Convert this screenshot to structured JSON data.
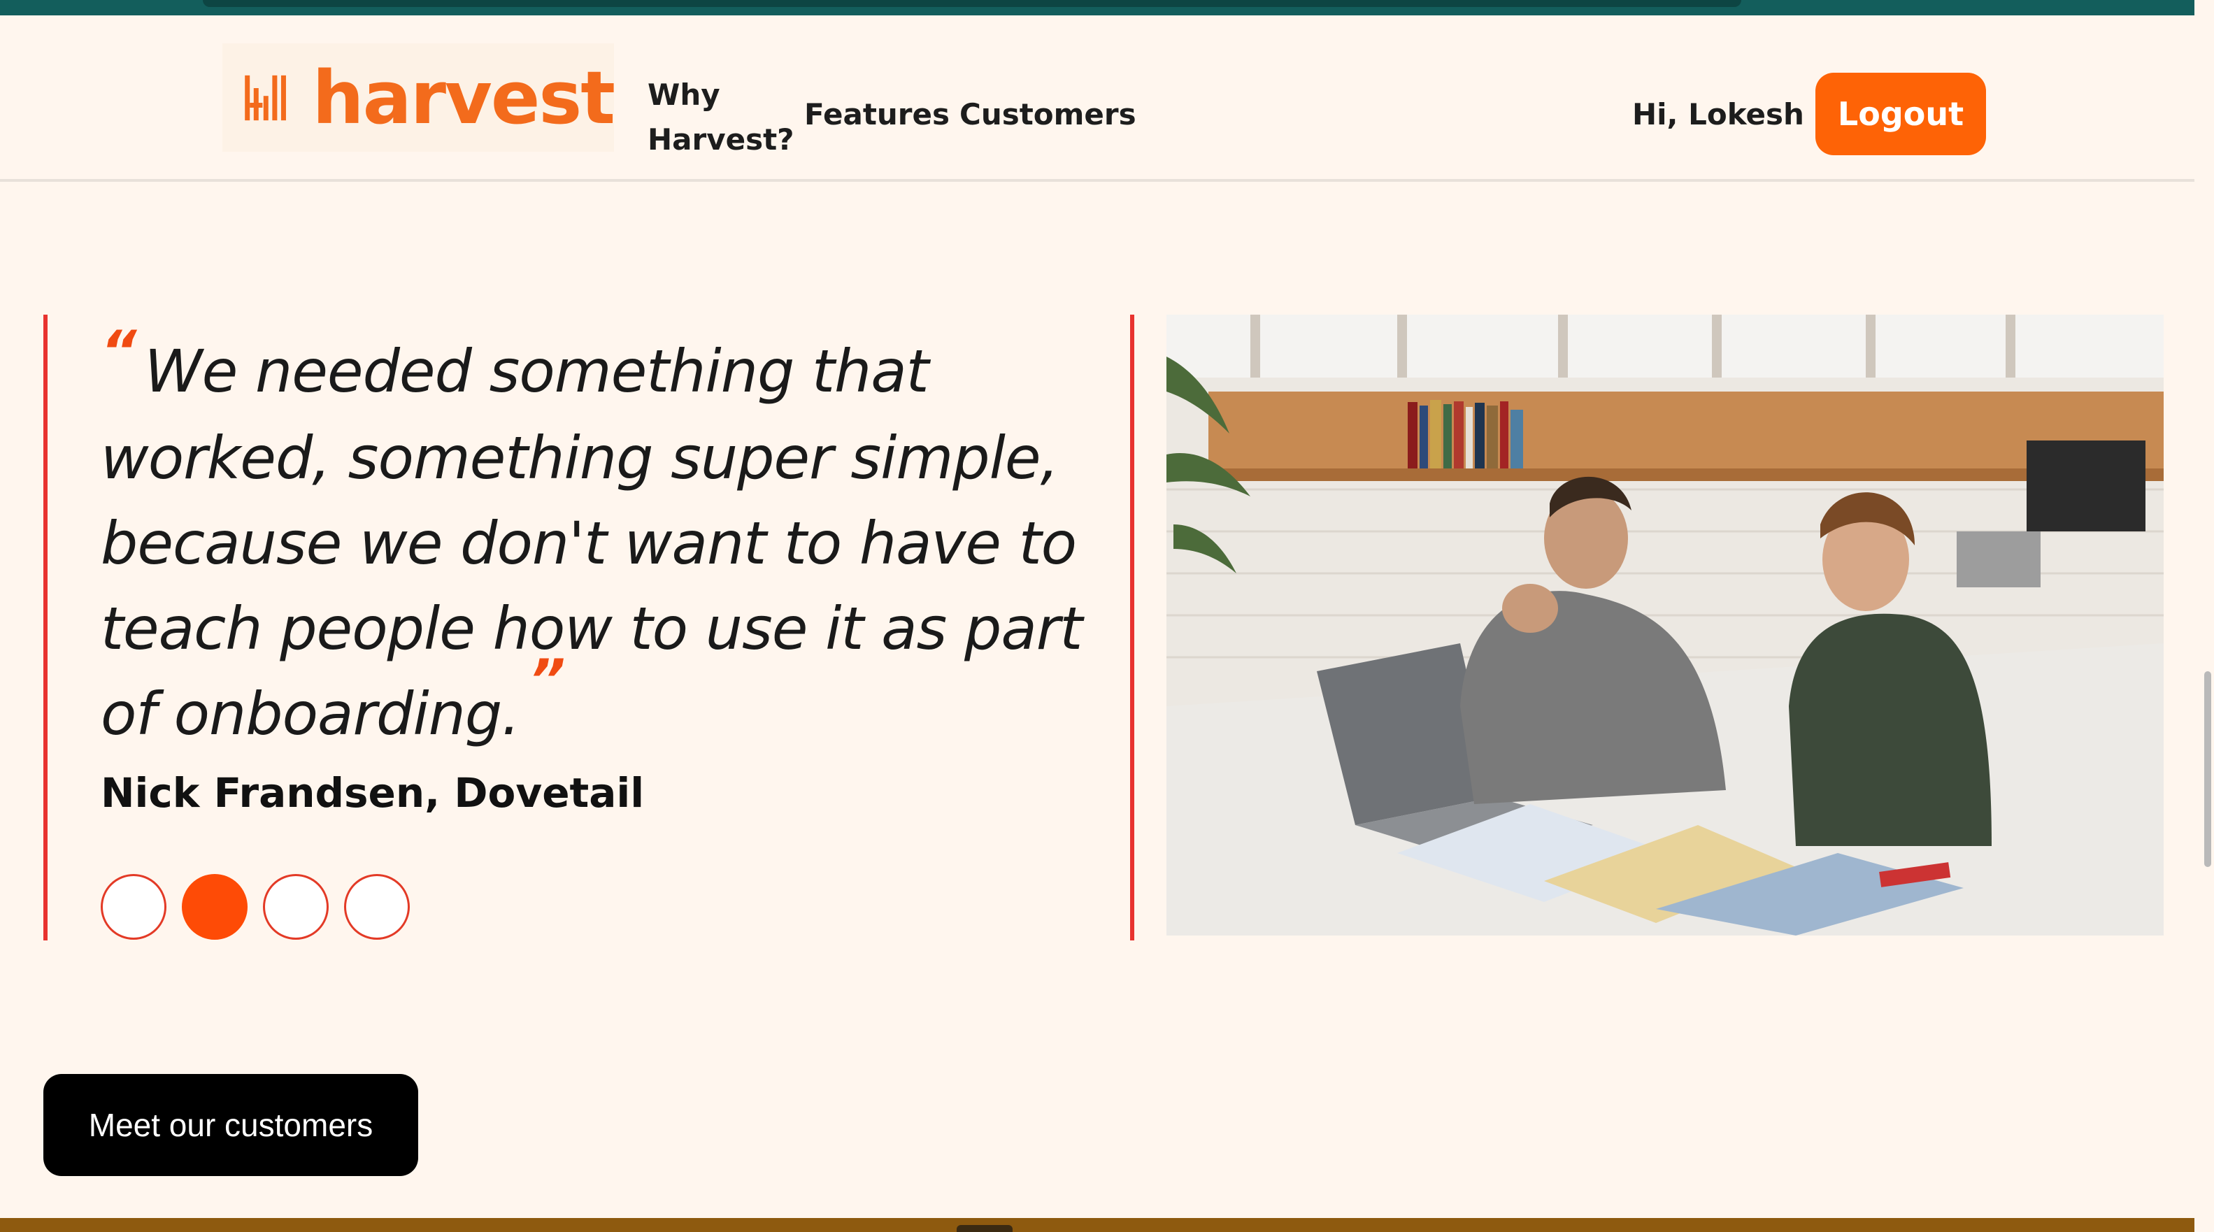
{
  "brand": {
    "name": "harvest",
    "color": "#f36b1c"
  },
  "nav": {
    "links": [
      "Why Harvest?",
      "Features",
      "Customers"
    ],
    "greeting": "Hi, Lokesh",
    "logout_label": "Logout"
  },
  "testimonial": {
    "open_quote": "“",
    "close_quote": "”",
    "quote": "We needed something that worked, something super simple, because we don't want to have to teach people how to use it as part of onboarding.",
    "author": "Nick Frandsen, Dovetail",
    "carousel": {
      "total": 4,
      "active_index": 1
    }
  },
  "cta": {
    "label": "Meet our customers"
  },
  "colors": {
    "accent": "#fe6306",
    "quote_mark": "#f04b12",
    "rule": "#e8332f",
    "background": "#fff6ee"
  }
}
